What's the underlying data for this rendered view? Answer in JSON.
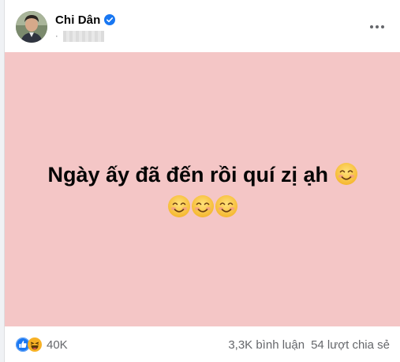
{
  "post": {
    "author": "Chi Dân",
    "meta_prefix": "·",
    "text": "Ngày ấy đã đến rồi quí zị ạh",
    "background_color": "#f4c6c6",
    "emoji": "smiling-face-with-smiling-eyes"
  },
  "footer": {
    "reaction_icons": [
      "like-icon",
      "haha-icon"
    ],
    "reaction_count": "40K",
    "comments": "3,3K bình luận",
    "shares": "54 lượt chia sẻ"
  },
  "colors": {
    "verified": "#1877f2",
    "like": "#1877f2",
    "haha": "#f7b125"
  }
}
